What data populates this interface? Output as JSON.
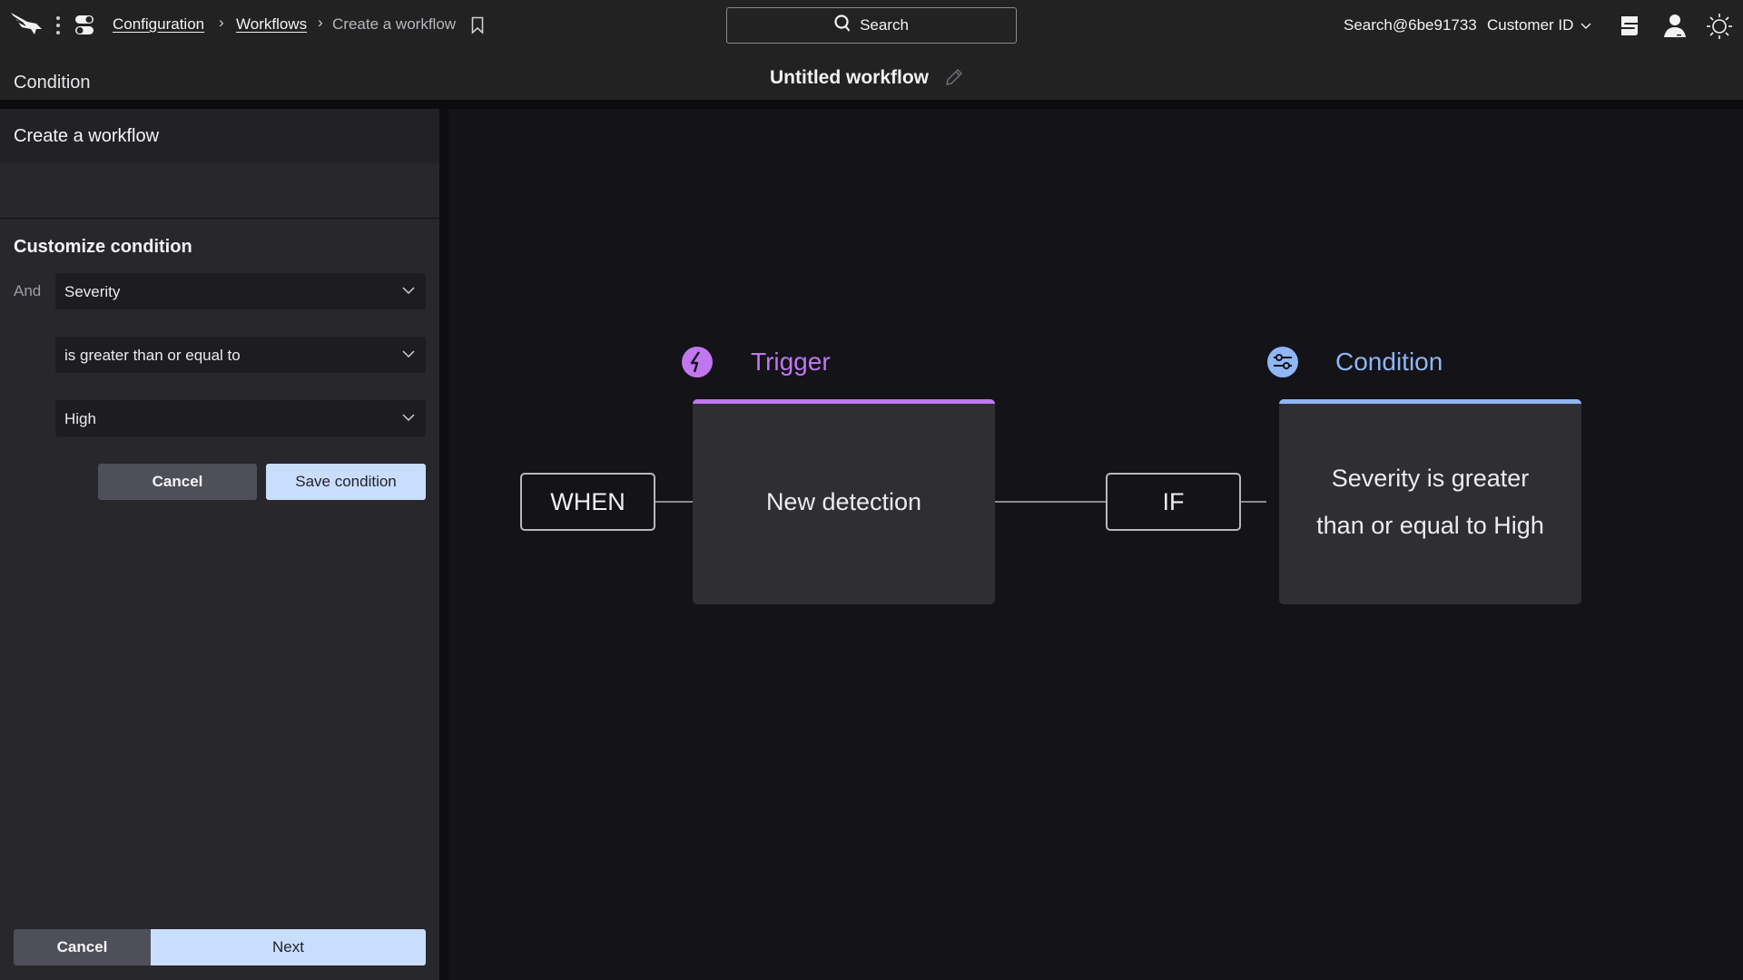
{
  "topbar": {
    "breadcrumb": [
      {
        "label": "Configuration",
        "link": true
      },
      {
        "label": "Workflows",
        "link": true
      },
      {
        "label": "Create a workflow",
        "link": false
      }
    ],
    "search_label": "Search",
    "user": "Search@6be91733",
    "customer_id_label": "Customer ID",
    "workflow_title": "Untitled workflow",
    "icons": [
      "falcon-logo-icon",
      "more-vertical-icon",
      "app-switcher-icon",
      "bookmark-icon",
      "search-icon",
      "chevron-down-icon",
      "messages-icon",
      "user-icon",
      "theme-sun-icon",
      "edit-pencil-icon"
    ]
  },
  "panel": {
    "title": "Create a workflow",
    "step": "Condition",
    "section_title": "Customize condition",
    "operator_prefix": "And",
    "field_select": "Severity",
    "comparison_select": "is greater than or equal to",
    "value_select": "High",
    "cancel_label": "Cancel",
    "save_label": "Save condition",
    "footer_cancel_label": "Cancel",
    "footer_next_label": "Next"
  },
  "canvas": {
    "when_label": "WHEN",
    "if_label": "IF",
    "trigger": {
      "title": "Trigger",
      "text": "New detection",
      "color": "#c077f0"
    },
    "condition": {
      "title": "Condition",
      "text_line1": "Severity is greater",
      "text_line2": "than or equal to High",
      "color": "#8fb6f5"
    }
  },
  "colors": {
    "primary_button": "#c9ddfc",
    "secondary_button": "#4f4f59",
    "trigger_accent": "#c077f0",
    "condition_accent": "#8fb6f5"
  }
}
